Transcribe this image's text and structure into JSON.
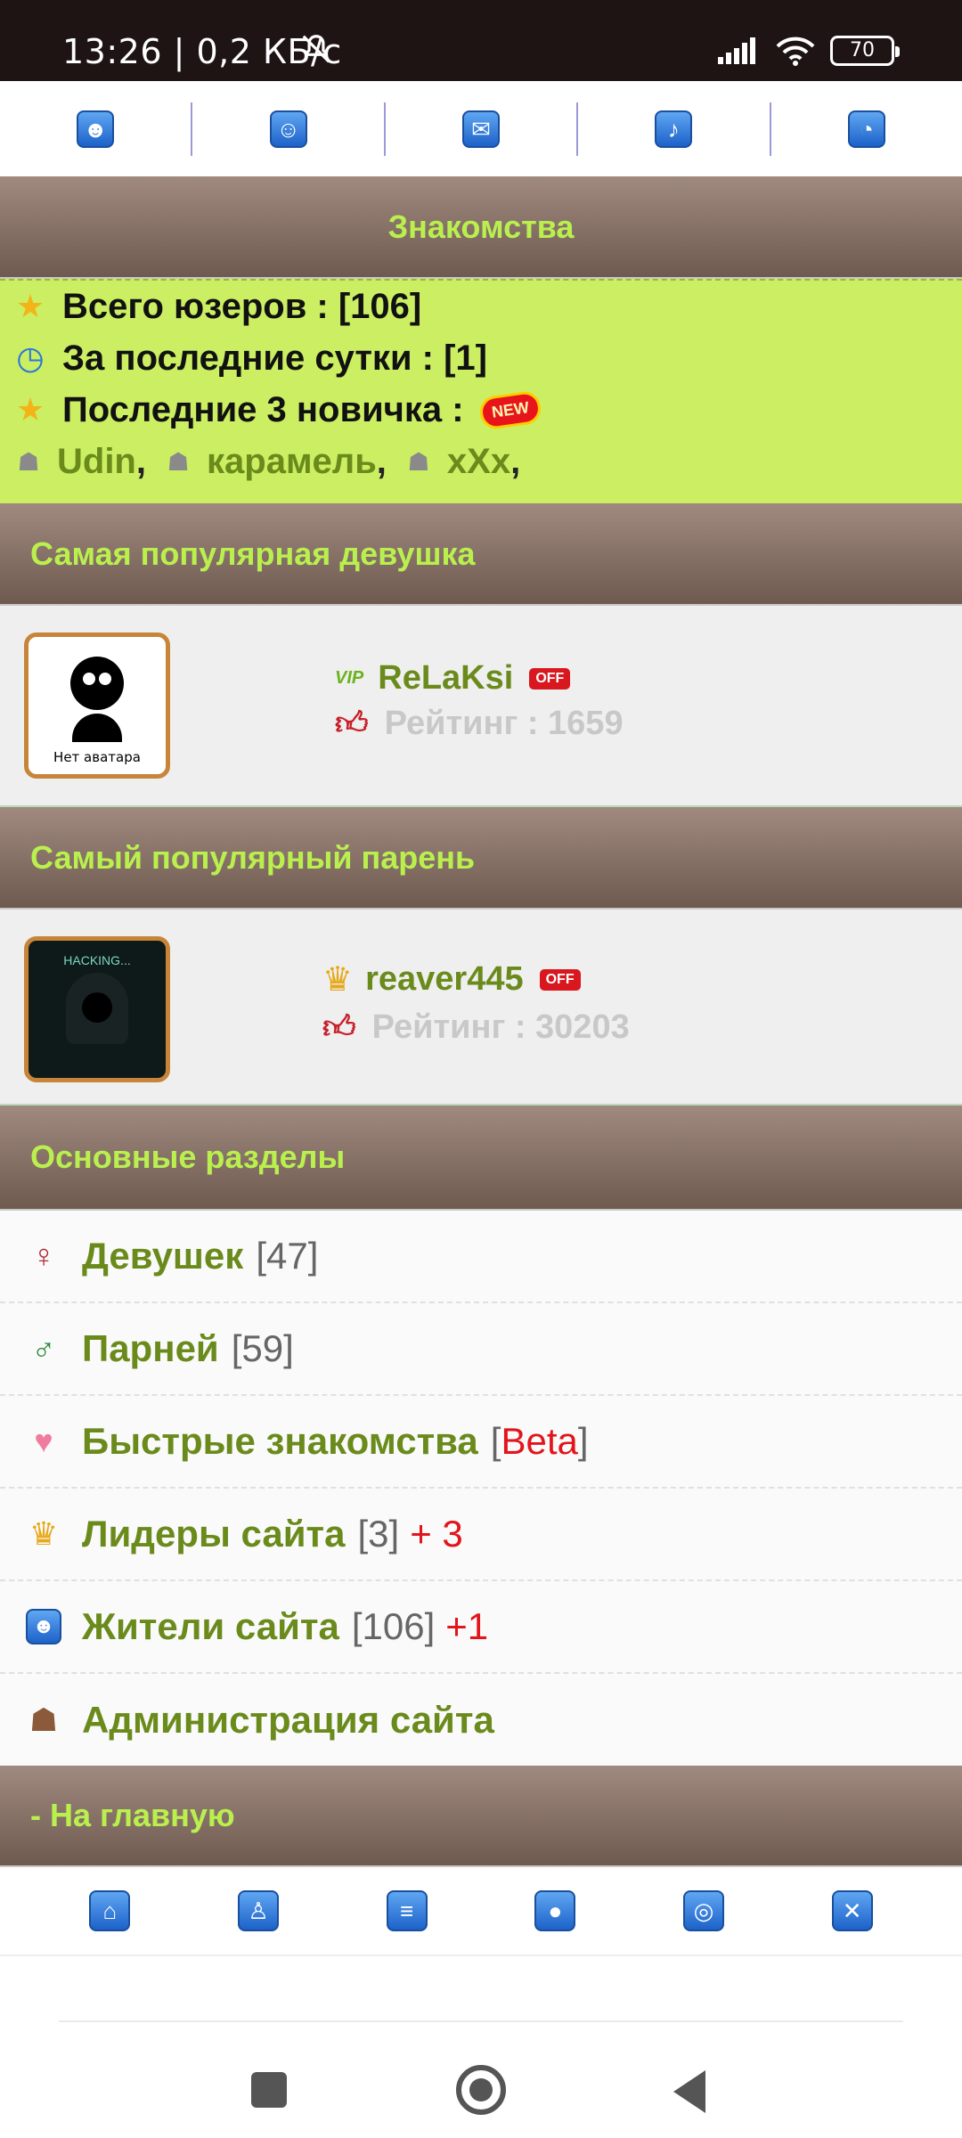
{
  "status_bar": {
    "time": "13:26 | 0,2 КБ/с",
    "battery": "70"
  },
  "top_nav": {
    "icons": [
      "user-icon",
      "smiley-icon",
      "mail-icon",
      "bell-icon",
      "rss-icon"
    ]
  },
  "dating": {
    "title": "Знакомства"
  },
  "stats": {
    "total_users": "Всего юзеров : [106]",
    "last_day": "За последние сутки : [1]",
    "last_newbies": "Последние 3 новичка :",
    "new_badge": "NEW",
    "newbies": [
      "Udin",
      "карамель",
      "xXx"
    ],
    "separator": ","
  },
  "popular_girl": {
    "header": "Самая популярная девушка",
    "avatar_caption": "Нет аватара",
    "vip_badge": "VIP",
    "username": "ReLaKsi",
    "status": "OFF",
    "rating": "Рейтинг : 1659"
  },
  "popular_guy": {
    "header": "Самый популярный парень",
    "avatar_text": "HACKING...",
    "username": "reaver445",
    "status": "OFF",
    "rating": "Рейтинг : 30203"
  },
  "sections": {
    "header": "Основные разделы",
    "items": [
      {
        "label": "Девушек",
        "count": "[47]",
        "extra": ""
      },
      {
        "label": "Парней",
        "count": "[59]",
        "extra": ""
      },
      {
        "label": "Быстрые знакомства",
        "count": "",
        "extra": ""
      },
      {
        "label": "Лидеры сайта",
        "count": "[3]",
        "extra": "+ 3"
      },
      {
        "label": "Жители сайта",
        "count": "[106]",
        "extra": "+1"
      },
      {
        "label": "Администрация сайта",
        "count": "",
        "extra": ""
      }
    ],
    "beta_open": "[",
    "beta": "Beta",
    "beta_close": "]"
  },
  "home_link": {
    "label": "- На главную"
  },
  "bottom_nav": {
    "icons": [
      "home-icon",
      "person-icon",
      "document-icon",
      "chat-icon",
      "target-icon",
      "close-icon"
    ]
  }
}
